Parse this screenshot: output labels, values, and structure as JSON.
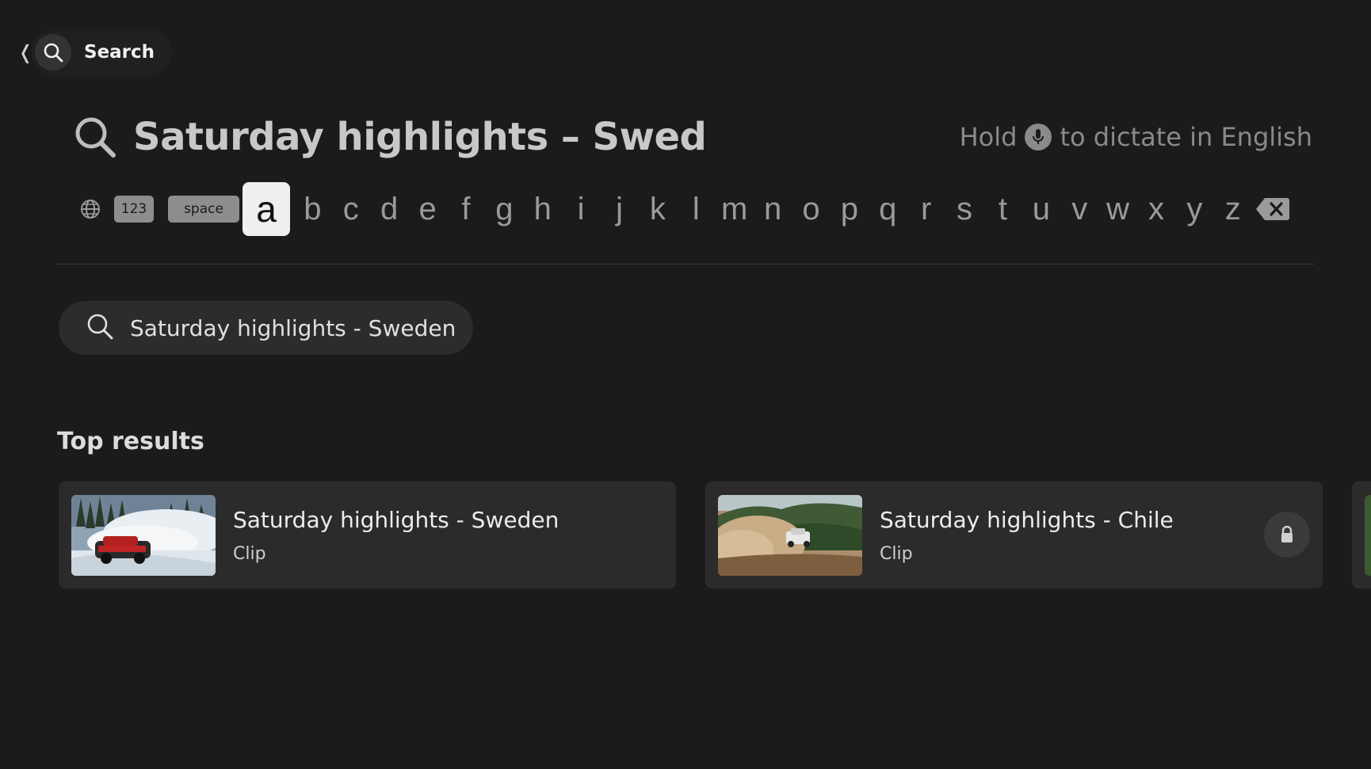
{
  "nav": {
    "back_glyph": "❬",
    "label": "Search",
    "icon": "search-icon"
  },
  "query": {
    "text": "Saturday highlights – Swed",
    "dictate_prefix": "Hold",
    "dictate_suffix": "to dictate in English"
  },
  "keyboard": {
    "globe_icon": "globe-icon",
    "numbers_label": "123",
    "space_label": "space",
    "letters": [
      "a",
      "b",
      "c",
      "d",
      "e",
      "f",
      "g",
      "h",
      "i",
      "j",
      "k",
      "l",
      "m",
      "n",
      "o",
      "p",
      "q",
      "r",
      "s",
      "t",
      "u",
      "v",
      "w",
      "x",
      "y",
      "z"
    ],
    "selected": "a",
    "delete_icon": "backspace-icon"
  },
  "suggestion": {
    "text": "Saturday highlights - Sweden"
  },
  "results": {
    "heading": "Top results",
    "items": [
      {
        "title": "Saturday highlights - Sweden",
        "subtitle": "Clip",
        "locked": false
      },
      {
        "title": "Saturday highlights - Chile",
        "subtitle": "Clip",
        "locked": true
      }
    ]
  },
  "colors": {
    "background": "#1b1b1b",
    "card": "#2b2b2b",
    "selected_key": "#efefef"
  }
}
